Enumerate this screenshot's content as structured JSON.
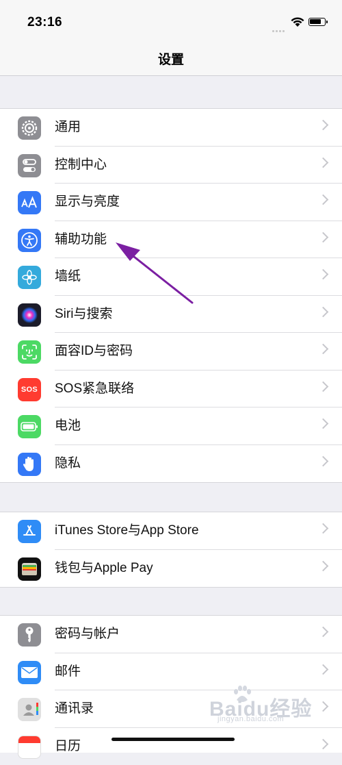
{
  "status_bar": {
    "time": "23:16"
  },
  "nav": {
    "title": "设置"
  },
  "groups": [
    [
      {
        "label": "通用",
        "icon": "gear-icon",
        "color": "#8e8e93"
      },
      {
        "label": "控制中心",
        "icon": "toggles-icon",
        "color": "#8e8e93"
      },
      {
        "label": "显示与亮度",
        "icon": "text-size-icon",
        "color": "#3478f6"
      },
      {
        "label": "辅助功能",
        "icon": "accessibility-icon",
        "color": "#3478f6"
      },
      {
        "label": "墙纸",
        "icon": "flower-icon",
        "color": "#34aadc"
      },
      {
        "label": "Siri与搜索",
        "icon": "siri-icon",
        "color": "#2b2b3a"
      },
      {
        "label": "面容ID与密码",
        "icon": "face-id-icon",
        "color": "#4cd964"
      },
      {
        "label": "SOS紧急联络",
        "icon": "sos-icon",
        "color": "#ff3b30",
        "badge": "SOS"
      },
      {
        "label": "电池",
        "icon": "battery-icon",
        "color": "#4cd964"
      },
      {
        "label": "隐私",
        "icon": "hand-icon",
        "color": "#3478f6"
      }
    ],
    [
      {
        "label": "iTunes Store与App Store",
        "icon": "app-store-icon",
        "color": "#2f8cf6"
      },
      {
        "label": "钱包与Apple Pay",
        "icon": "wallet-icon",
        "color": "#111111"
      }
    ],
    [
      {
        "label": "密码与帐户",
        "icon": "key-icon",
        "color": "#8e8e93"
      },
      {
        "label": "邮件",
        "icon": "mail-icon",
        "color": "#2f8cf6"
      },
      {
        "label": "通讯录",
        "icon": "contacts-icon",
        "color": "#d9d9d9"
      },
      {
        "label": "日历",
        "icon": "calendar-icon",
        "color": "#ffffff"
      }
    ]
  ],
  "watermark": {
    "main": "Baidu经验",
    "sub": "jingyan.baidu.com"
  },
  "colors": {
    "background": "#efeff4",
    "arrow": "#7b1fa2"
  }
}
